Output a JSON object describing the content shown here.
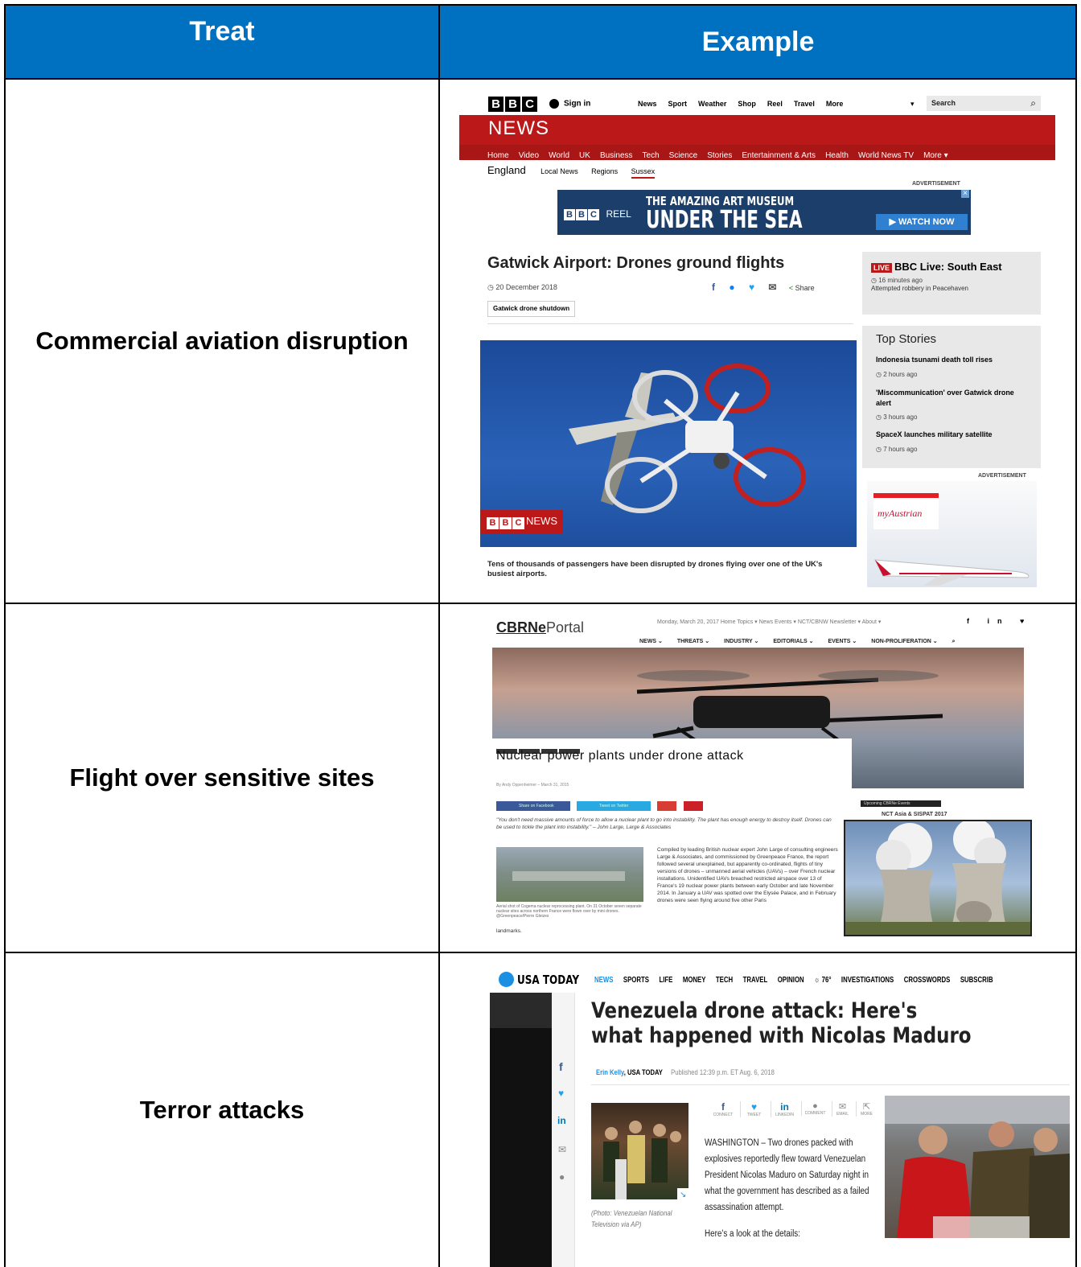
{
  "table": {
    "headers": {
      "treat": "Treat",
      "example": "Example"
    },
    "rows": [
      {
        "treat": "Commercial aviation disruption"
      },
      {
        "treat": "Flight over sensitive sites"
      },
      {
        "treat": "Terror attacks"
      }
    ]
  },
  "bbc": {
    "logo": [
      "B",
      "B",
      "C"
    ],
    "sign_in": "Sign in",
    "nav": [
      "News",
      "Sport",
      "Weather",
      "Shop",
      "Reel",
      "Travel",
      "More"
    ],
    "search_placeholder": "Search",
    "news_title": "NEWS",
    "subnav": [
      "Home",
      "Video",
      "World",
      "UK",
      "Business",
      "Tech",
      "Science",
      "Stories",
      "Entertainment & Arts",
      "Health",
      "World News TV",
      "More ▾"
    ],
    "region": "England",
    "region_links": [
      "Local News",
      "Regions",
      "Sussex"
    ],
    "advertisement": "ADVERTISEMENT",
    "ad_reel": "REEL",
    "ad_line1": "THE AMAZING ART MUSEUM",
    "ad_line2": "UNDER THE SEA",
    "ad_cta": "▶ WATCH NOW",
    "headline": "Gatwick Airport: Drones ground flights",
    "date": "20 December 2018",
    "share": "Share",
    "tag": "Gatwick drone shutdown",
    "live_badge": "LIVE",
    "live_title": "BBC Live: South East",
    "live_time": "16 minutes ago",
    "live_text": "Attempted robbery in Peacehaven",
    "top_stories_title": "Top Stories",
    "top_stories": [
      {
        "title": "Indonesia tsunami death toll rises",
        "time": "2 hours ago"
      },
      {
        "title": "'Miscommunication' over Gatwick drone alert",
        "time": "3 hours ago"
      },
      {
        "title": "SpaceX launches military satellite",
        "time": "7 hours ago"
      }
    ],
    "ad2_label": "ADVERTISEMENT",
    "ad2_brand": "myAustrian",
    "image_logo_text": "NEWS",
    "caption": "Tens of thousands of passengers have been disrupted by drones flying over one of the UK's busiest airports."
  },
  "cbrn": {
    "logo_bold": "CBRNe",
    "logo_light": "Portal",
    "nav": [
      "NEWS ⌄",
      "THREATS ⌄",
      "INDUSTRY ⌄",
      "EDITORIALS ⌄",
      "EVENTS ⌄",
      "NON-PROLIFERATION ⌄"
    ],
    "top_links": "Monday, March 20, 2017   Home   Topics ▾   News   Events ▾   NCT/CBNW Newsletter ▾   About ▾",
    "headline": "Nuclear power plants under drone attack",
    "byline": "By Andy Oppenheimer  –  March 31, 2015",
    "share_fb": "Share on Facebook",
    "share_tw": "Tweet on Twitter",
    "quote": "\"You don't need massive amounts of force to allow a nuclear plant to go into instability. The plant has enough energy to destroy itself. Drones can be used to tickle the plant into instability.\" – John Large, Large & Associates",
    "body": "Compiled by leading British nuclear expert John Large of consulting engineers Large & Associates, and commissioned by Greenpeace France, the report followed several unexplained, but apparently co-ordinated, flights of tiny versions of drones – unmanned aerial vehicles (UAVs) – over French nuclear installations. Unidentified UAVs breached restricted airspace over 13 of France's 19 nuclear power plants between early October and late November 2014. In January a UAV was spotted over the Elysée Palace, and in February drones were seen flying around five other Paris",
    "img_caption": "Aerial shot of Cogema nuclear reprocessing plant. On 31 October seven separate nuclear sites across northern France were flown over by mini drones. @Greenpeace/Pierre Gleizes",
    "tail": "landmarks.",
    "events_label": "Upcoming CBRNe Events",
    "event_name": "NCT Asia & SISPAT 2017"
  },
  "usa": {
    "logo": "USA TODAY",
    "nav": [
      "NEWS",
      "SPORTS",
      "LIFE",
      "MONEY",
      "TECH",
      "TRAVEL",
      "OPINION"
    ],
    "weather": "76°",
    "nav2": [
      "INVESTIGATIONS",
      "CROSSWORDS",
      "SUBSCRIB"
    ],
    "headline": "Venezuela drone attack: Here's what happened with Nicolas Maduro",
    "author": "Erin Kelly",
    "outlet": ", USA TODAY",
    "published": "Published 12:39 p.m. ET Aug. 6, 2018",
    "share_labels": [
      "CONNECT",
      "TWEET",
      "LINKEDIN",
      "COMMENT",
      "EMAIL",
      "MORE"
    ],
    "photo_caption": "(Photo: Venezuelan National Television via AP)",
    "body": "WASHINGTON – Two drones packed with explosives reportedly flew toward Venezuelan President Nicolas Maduro on Saturday night in what the government has described as a failed assassination attempt.",
    "details": "Here's a look at the details:"
  }
}
